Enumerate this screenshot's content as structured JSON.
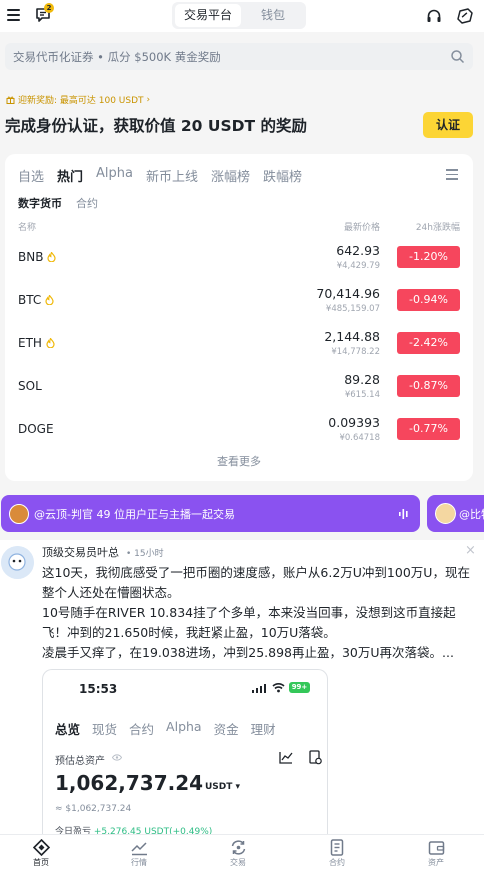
{
  "topbar": {
    "notification_count": "2",
    "segment": {
      "active": "交易平台",
      "inactive": "钱包"
    }
  },
  "search": {
    "placeholder": "交易代币化证券 • 瓜分 $500K 黄金奖励"
  },
  "promo": {
    "small": "迎新奖励: 最高可达 100 USDT",
    "chevron": "›",
    "title": "完成身份认证，获取价值 20 USDT 的奖励",
    "button": "认证"
  },
  "market": {
    "tabs": [
      "自选",
      "热门",
      "Alpha",
      "新币上线",
      "涨幅榜",
      "跌幅榜"
    ],
    "active_tab": "热门",
    "subtabs": [
      "数字货币",
      "合约"
    ],
    "columns": {
      "name": "名称",
      "price": "最新价格",
      "change": "24h涨跌幅"
    },
    "rows": [
      {
        "symbol": "BNB",
        "hot": true,
        "price": "642.93",
        "fiat": "¥4,429.79",
        "change": "-1.20%"
      },
      {
        "symbol": "BTC",
        "hot": true,
        "price": "70,414.96",
        "fiat": "¥485,159.07",
        "change": "-0.94%"
      },
      {
        "symbol": "ETH",
        "hot": true,
        "price": "2,144.88",
        "fiat": "¥14,778.22",
        "change": "-2.42%"
      },
      {
        "symbol": "SOL",
        "hot": false,
        "price": "89.28",
        "fiat": "¥615.14",
        "change": "-0.87%"
      },
      {
        "symbol": "DOGE",
        "hot": false,
        "price": "0.09393",
        "fiat": "¥0.64718",
        "change": "-0.77%"
      }
    ],
    "see_more": "查看更多",
    "down_color": "#f6465d"
  },
  "live": {
    "text": "@云顶-判官   49 位用户正与主播一起交易",
    "next_text": "@比特"
  },
  "post": {
    "author": "顶级交易员叶总",
    "time": "• 15小时",
    "close": "×",
    "body": [
      "这10天，我彻底感受了一把币圈的速度感，账户从6.2万U冲到100万U，现在整个人还处在懵圈状态。",
      "10号随手在RIVER 10.834挂了个多单，本来没当回事，没想到这币直接起飞！冲到的21.650时候，我赶紧止盈，10万U落袋。",
      "凌晨手又痒了，在19.038进场，冲到25.898再止盈，30万U再次落袋。..."
    ],
    "screenshot": {
      "clock": "15:53",
      "battery": "99+",
      "tabs": [
        "总览",
        "现货",
        "合约",
        "Alpha",
        "资金",
        "理财"
      ],
      "est_label": "预估总资产",
      "total": "1,062,737.24",
      "unit": "USDT ▾",
      "usd": "≈ $1,062,737.24",
      "pnl_label": "今日盈亏",
      "pnl_value": "+5,276.45 USDT(+0.49%)"
    }
  },
  "nav": [
    {
      "label": "首页",
      "icon": "home-icon"
    },
    {
      "label": "行情",
      "icon": "markets-icon"
    },
    {
      "label": "交易",
      "icon": "trade-icon"
    },
    {
      "label": "合约",
      "icon": "futures-icon"
    },
    {
      "label": "资产",
      "icon": "wallet-icon"
    }
  ]
}
